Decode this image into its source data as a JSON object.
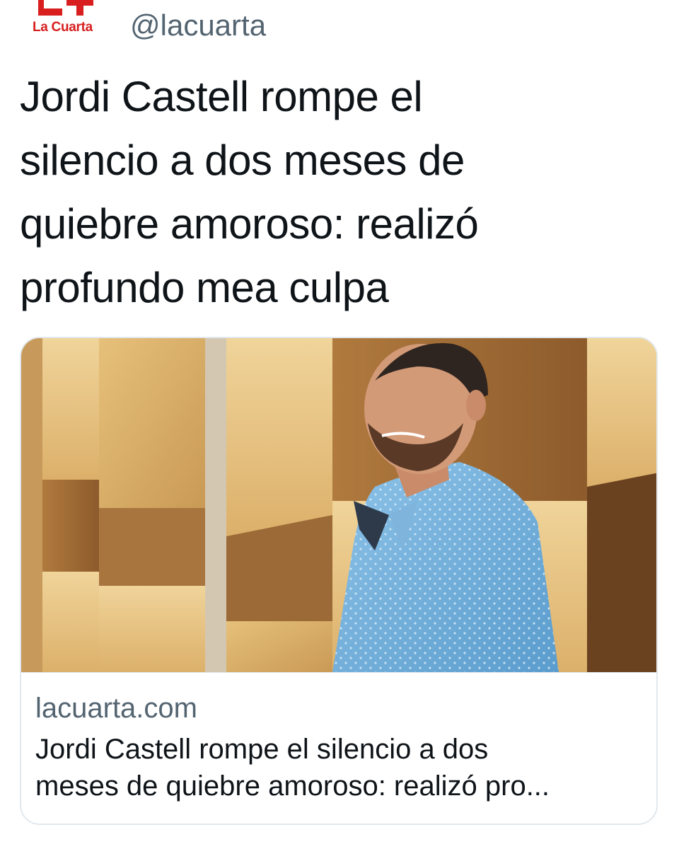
{
  "source": {
    "logo_text": "La Cuarta",
    "handle": "@lacuarta",
    "brand_color": "#d81e1e"
  },
  "tweet": {
    "lines": [
      "Jordi Castell rompe el",
      "silencio a dos meses de",
      "quiebre amoroso: realizó",
      "profundo mea culpa"
    ]
  },
  "card": {
    "image_icon": "article-photo",
    "domain": "lacuarta.com",
    "title_lines": [
      "Jordi Castell rompe el silencio a dos",
      "meses de quiebre amoroso: realizó pro..."
    ]
  },
  "colors": {
    "text": "#0f1419",
    "muted": "#536471",
    "border": "#e1e8ed"
  }
}
